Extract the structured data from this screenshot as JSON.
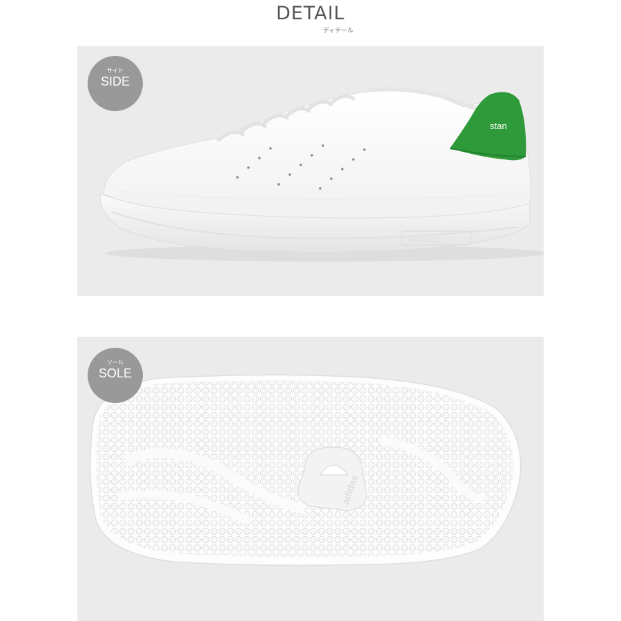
{
  "header": {
    "title": "DETAIL",
    "subtitle": "ディテール"
  },
  "side_view": {
    "badge_small": "サイド",
    "badge_label": "SIDE",
    "tab_text": "stan",
    "sidewall_brand": "adidas",
    "image": "white sneaker side view with green heel tab"
  },
  "sole_view": {
    "badge_small": "ソール",
    "badge_label": "SOLE",
    "outsole_brand": "adidas",
    "image": "white outsole with hexagonal dot pattern"
  },
  "colors": {
    "background": "#ebebeb",
    "badge": "#999999",
    "accent_green": "#2e9a3a"
  }
}
